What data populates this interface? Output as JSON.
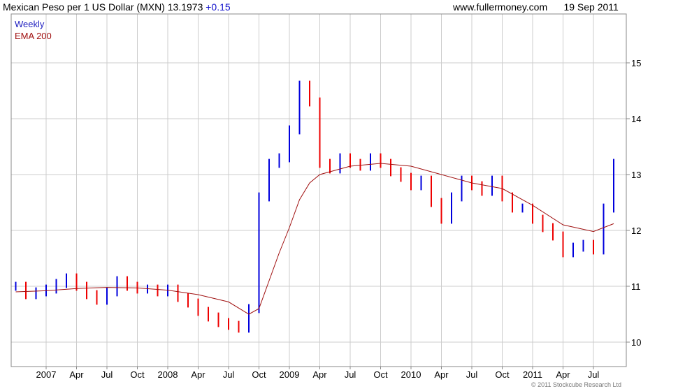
{
  "header": {
    "instrument": "Mexican Peso per 1 US Dollar (MXN)",
    "last": "13.1973",
    "change": "+0.15",
    "source": "www.fullermoney.com",
    "date": "19 Sep 2011"
  },
  "legend": [
    {
      "label": "Weekly",
      "color": "#2020c0"
    },
    {
      "label": "EMA 200",
      "color": "#a01010"
    }
  ],
  "copyright": "© 2011 Stockcube Research Ltd",
  "colors": {
    "up": "#0000dd",
    "down": "#ee0000",
    "ema": "#a01010",
    "grid": "#cccccc"
  },
  "chart_data": {
    "type": "line",
    "title": "Mexican Peso per 1 US Dollar (MXN)",
    "x_ticks": [
      "2007",
      "Apr",
      "Jul",
      "Oct",
      "2008",
      "Apr",
      "Jul",
      "Oct",
      "2009",
      "Apr",
      "Jul",
      "Oct",
      "2010",
      "Apr",
      "Jul",
      "Oct",
      "2011",
      "Apr",
      "Jul"
    ],
    "y_ticks": [
      10,
      11,
      12,
      13,
      14,
      15
    ],
    "ylim": [
      9.6,
      15.9
    ],
    "grid": true,
    "legend_position": "top-left",
    "series": [
      {
        "name": "Weekly",
        "x": [
          "2006-10",
          "2006-11",
          "2006-12",
          "2007-01",
          "2007-02",
          "2007-03",
          "2007-04",
          "2007-05",
          "2007-06",
          "2007-07",
          "2007-08",
          "2007-09",
          "2007-10",
          "2007-11",
          "2007-12",
          "2008-01",
          "2008-02",
          "2008-03",
          "2008-04",
          "2008-05",
          "2008-06",
          "2008-07",
          "2008-08",
          "2008-09",
          "2008-10",
          "2008-11",
          "2008-12",
          "2009-01",
          "2009-02",
          "2009-03",
          "2009-04",
          "2009-05",
          "2009-06",
          "2009-07",
          "2009-08",
          "2009-09",
          "2009-10",
          "2009-11",
          "2009-12",
          "2010-01",
          "2010-02",
          "2010-03",
          "2010-04",
          "2010-05",
          "2010-06",
          "2010-07",
          "2010-08",
          "2010-09",
          "2010-10",
          "2010-11",
          "2010-12",
          "2011-01",
          "2011-02",
          "2011-03",
          "2011-04",
          "2011-05",
          "2011-06",
          "2011-07",
          "2011-08",
          "2011-09"
        ],
        "values": [
          11.0,
          10.85,
          10.9,
          10.95,
          11.05,
          11.15,
          11.0,
          10.85,
          10.75,
          10.9,
          11.1,
          11.0,
          10.95,
          10.95,
          10.9,
          10.95,
          10.8,
          10.7,
          10.55,
          10.45,
          10.35,
          10.3,
          10.25,
          10.6,
          12.6,
          13.2,
          13.3,
          13.8,
          14.6,
          14.3,
          13.2,
          13.1,
          13.3,
          13.2,
          13.15,
          13.3,
          13.2,
          13.05,
          12.95,
          12.8,
          12.9,
          12.5,
          12.2,
          12.6,
          12.9,
          12.8,
          12.7,
          12.9,
          12.6,
          12.4,
          12.4,
          12.2,
          12.05,
          11.9,
          11.6,
          11.7,
          11.75,
          11.65,
          12.4,
          13.2
        ]
      },
      {
        "name": "EMA 200",
        "x": [
          "2006-10",
          "2007-01",
          "2007-04",
          "2007-07",
          "2007-10",
          "2008-01",
          "2008-04",
          "2008-07",
          "2008-09",
          "2008-10",
          "2008-11",
          "2008-12",
          "2009-01",
          "2009-02",
          "2009-03",
          "2009-04",
          "2009-07",
          "2009-10",
          "2010-01",
          "2010-04",
          "2010-07",
          "2010-10",
          "2011-01",
          "2011-04",
          "2011-07",
          "2011-09"
        ],
        "values": [
          10.9,
          10.92,
          10.96,
          10.98,
          10.97,
          10.93,
          10.85,
          10.72,
          10.5,
          10.6,
          11.1,
          11.6,
          12.05,
          12.55,
          12.85,
          13.0,
          13.15,
          13.2,
          13.15,
          13.0,
          12.85,
          12.75,
          12.45,
          12.1,
          11.98,
          12.12
        ]
      }
    ]
  }
}
